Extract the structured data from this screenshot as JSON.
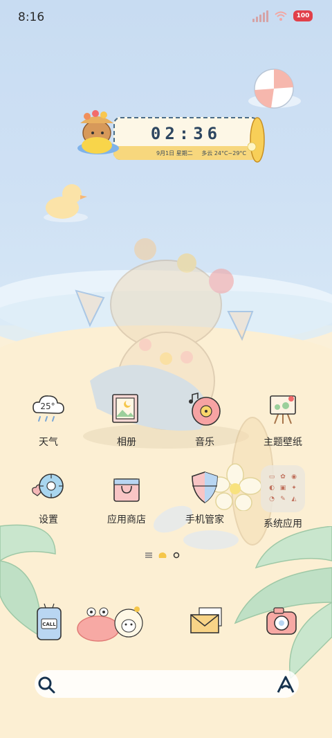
{
  "status": {
    "time": "8:16",
    "battery": "100"
  },
  "clock": {
    "time": "02:36",
    "date": "9月1日 星期二",
    "weather": "多云 24°C~29°C"
  },
  "weather_icon": {
    "temp": "25°"
  },
  "apps_row1": [
    {
      "label": "天气",
      "icon": "weather-cloud-icon"
    },
    {
      "label": "相册",
      "icon": "photo-frame-icon"
    },
    {
      "label": "音乐",
      "icon": "music-record-icon"
    },
    {
      "label": "主题壁纸",
      "icon": "theme-easel-icon"
    }
  ],
  "apps_row2": [
    {
      "label": "设置",
      "icon": "gear-icon"
    },
    {
      "label": "应用商店",
      "icon": "shopping-bag-icon"
    },
    {
      "label": "手机管家",
      "icon": "shield-icon"
    },
    {
      "label": "系统应用",
      "icon": "folder-icon"
    }
  ],
  "dock": [
    {
      "name": "phone",
      "icon": "call-phone-icon",
      "text": "CALL"
    },
    {
      "name": "messages",
      "icon": "crab-icon"
    },
    {
      "name": "mail",
      "icon": "envelope-icon"
    },
    {
      "name": "camera",
      "icon": "camera-icon"
    }
  ],
  "colors": {
    "accent": "#2d4660",
    "battery": "#e1404a",
    "sand": "#fcefd3",
    "sky": "#c8dcf2"
  }
}
